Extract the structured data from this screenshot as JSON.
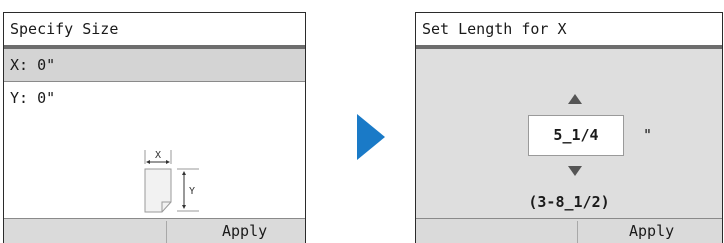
{
  "specify_size": {
    "title": "Specify Size",
    "rows": [
      {
        "label": "X: 0\""
      },
      {
        "label": "Y: 0\""
      }
    ],
    "diagram": {
      "x_label": "X",
      "y_label": "Y"
    },
    "apply_label": "Apply"
  },
  "set_length": {
    "title": "Set Length for X",
    "value": "5_1/4",
    "unit": "\"",
    "range": "(3-8_1/2)",
    "apply_label": "Apply"
  },
  "colors": {
    "arrow": "#1a7ac7",
    "title_underline": "#6d6d6d",
    "selected_row": "#d4d4d4",
    "panel_bg": "#dedede",
    "footer_bg": "#dadada"
  }
}
